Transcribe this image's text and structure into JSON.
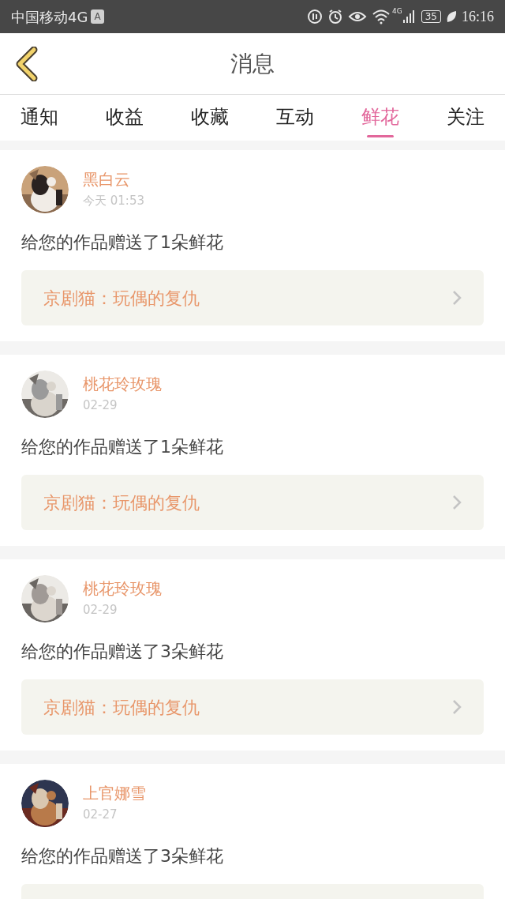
{
  "status_bar": {
    "carrier": "中国移动4G",
    "badge": "A",
    "network": "4G",
    "battery": "35",
    "time": "16:16"
  },
  "header": {
    "title": "消息"
  },
  "tabs": [
    {
      "label": "通知",
      "selected": false
    },
    {
      "label": "收益",
      "selected": false
    },
    {
      "label": "收藏",
      "selected": false
    },
    {
      "label": "互动",
      "selected": false
    },
    {
      "label": "鲜花",
      "selected": true
    },
    {
      "label": "关注",
      "selected": false
    }
  ],
  "messages": [
    {
      "name": "黑白云",
      "time": "今天 01:53",
      "text": "给您的作品赠送了1朵鲜花",
      "link": "京剧猫：玩偶的复仇"
    },
    {
      "name": "桃花玲玫瑰",
      "time": "02-29",
      "text": "给您的作品赠送了1朵鲜花",
      "link": "京剧猫：玩偶的复仇"
    },
    {
      "name": "桃花玲玫瑰",
      "time": "02-29",
      "text": "给您的作品赠送了3朵鲜花",
      "link": "京剧猫：玩偶的复仇"
    },
    {
      "name": "上官娜雪",
      "time": "02-27",
      "text": "给您的作品赠送了3朵鲜花"
    }
  ]
}
